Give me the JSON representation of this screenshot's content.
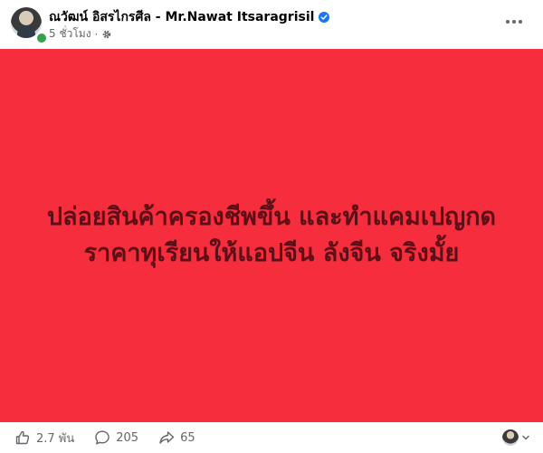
{
  "post": {
    "author": "ณวัฒน์ อิสรไกรศีล - Mr.Nawat Itsaragrisil",
    "time": "5 ชั่วโมง",
    "separator": "·",
    "body_lines": [
      "ปล่อยสินค้าครองชีพขึ้น และทำแคมเปญกด",
      "ราคาทุเรียนให้แอปจีน ลังจีน จริงมั้ย"
    ],
    "background_color": "#f52d3c",
    "text_color": "#5c0f17"
  },
  "stats": {
    "likes": "2.7 พัน",
    "comments": "205",
    "shares": "65"
  },
  "icons": {
    "verified": "verified-badge-icon",
    "privacy": "gear-icon",
    "like": "thumbs-up-icon",
    "comment": "comment-bubble-icon",
    "share": "share-arrow-icon",
    "more": "more-dots-icon",
    "caret": "chevron-down-icon"
  }
}
